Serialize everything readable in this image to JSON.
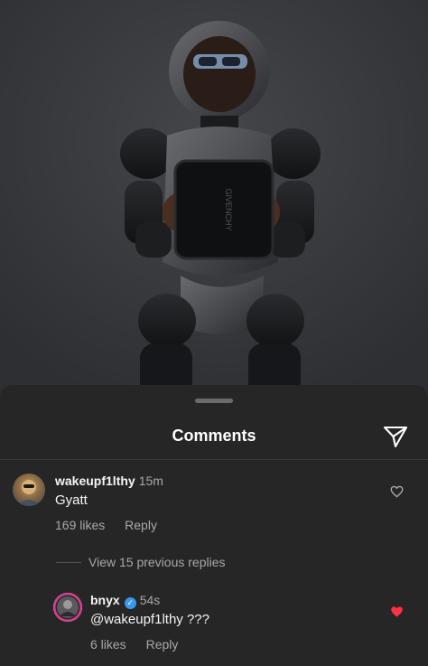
{
  "sheet": {
    "title": "Comments"
  },
  "comments": [
    {
      "username": "wakeupf1lthy",
      "time": "15m",
      "text": "Gyatt",
      "likes": "169 likes",
      "reply_label": "Reply",
      "liked": false
    }
  ],
  "view_replies": "View 15 previous replies",
  "replies": [
    {
      "username": "bnyx",
      "verified": true,
      "time": "54s",
      "text": "@wakeupf1lthy ???",
      "likes": "6 likes",
      "reply_label": "Reply",
      "liked": true
    }
  ],
  "colors": {
    "liked_heart": "#ff3040",
    "verified_badge": "#3897f0",
    "sheet_bg": "#262627"
  },
  "icons": {
    "share": "paper-plane-icon",
    "like": "heart-outline-icon",
    "liked": "heart-filled-icon"
  }
}
